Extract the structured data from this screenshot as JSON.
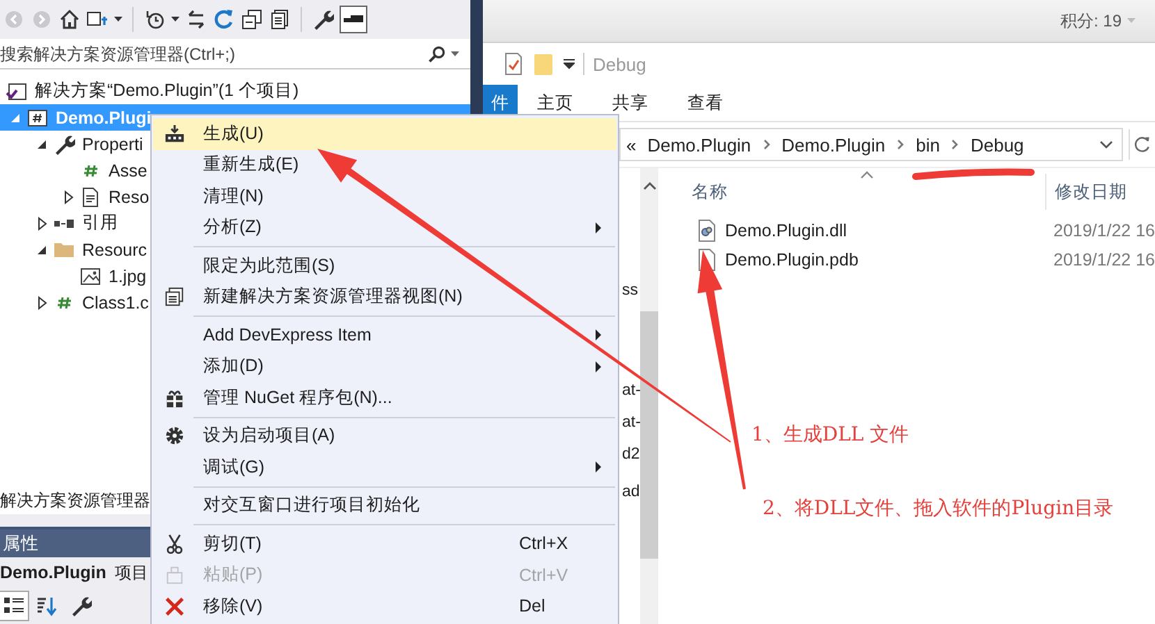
{
  "solution_explorer": {
    "search": {
      "placeholder": "搜索解决方案资源管理器(Ctrl+;)"
    },
    "solution": {
      "label": "解决方案“Demo.Plugin”(1 个项目)",
      "selected": false
    },
    "tree": [
      {
        "label": "Demo.Plugi",
        "kind": "project",
        "expanded": true,
        "selected": true,
        "children": [
          {
            "label": "Properti",
            "kind": "properties",
            "expanded": true,
            "selected": false,
            "children": [
              {
                "label": "Asse",
                "kind": "code",
                "selected": false
              },
              {
                "label": "Reso",
                "kind": "resx",
                "expanded": false,
                "selected": false
              }
            ]
          },
          {
            "label": "引用",
            "kind": "references",
            "expanded": false,
            "selected": false
          },
          {
            "label": "Resourc",
            "kind": "folder",
            "expanded": true,
            "selected": false,
            "children": [
              {
                "label": "1.jpg",
                "kind": "image",
                "selected": false
              }
            ]
          },
          {
            "label": "Class1.c",
            "kind": "code",
            "expanded": false,
            "selected": false
          }
        ]
      }
    ],
    "tab_label": "解决方案资源管理器",
    "properties": {
      "title": "属性",
      "object_name": "Demo.Plugin",
      "object_type": "项目"
    }
  },
  "context_menu": [
    {
      "kind": "build",
      "label": "生成(U)",
      "highlighted": true
    },
    {
      "kind": "plain",
      "label": "重新生成(E)",
      "highlighted": false
    },
    {
      "kind": "plain",
      "label": "清理(N)",
      "highlighted": false
    },
    {
      "kind": "plain",
      "label": "分析(Z)",
      "submenu": true,
      "highlighted": false
    },
    {
      "kind": "separator"
    },
    {
      "kind": "plain",
      "label": "限定为此范围(S)",
      "highlighted": false
    },
    {
      "kind": "view",
      "label": "新建解决方案资源管理器视图(N)",
      "highlighted": false
    },
    {
      "kind": "separator"
    },
    {
      "kind": "plain",
      "label": "Add DevExpress Item",
      "submenu": true,
      "highlighted": false
    },
    {
      "kind": "plain",
      "label": "添加(D)",
      "submenu": true,
      "highlighted": false
    },
    {
      "kind": "package",
      "label": "管理 NuGet 程序包(N)...",
      "highlighted": false
    },
    {
      "kind": "separator"
    },
    {
      "kind": "gear",
      "label": "设为启动项目(A)",
      "highlighted": false
    },
    {
      "kind": "plain",
      "label": "调试(G)",
      "submenu": true,
      "highlighted": false
    },
    {
      "kind": "separator"
    },
    {
      "kind": "plain",
      "label": "对交互窗口进行项目初始化",
      "highlighted": false
    },
    {
      "kind": "separator"
    },
    {
      "kind": "cut",
      "label": "剪切(T)",
      "shortcut": "Ctrl+X",
      "highlighted": false
    },
    {
      "kind": "paste",
      "label": "粘贴(P)",
      "shortcut": "Ctrl+V",
      "disabled": true,
      "highlighted": false
    },
    {
      "kind": "remove",
      "label": "移除(V)",
      "shortcut": "Del",
      "highlighted": false
    }
  ],
  "explorer": {
    "points": "积分: 19",
    "title": "Debug",
    "ribbon_tabs": [
      {
        "label": "件",
        "selected": true
      },
      {
        "label": "主页",
        "selected": false
      },
      {
        "label": "共享",
        "selected": false
      },
      {
        "label": "查看",
        "selected": false
      }
    ],
    "overflow_mark": "«",
    "breadcrumb": [
      "Demo.Plugin",
      "Demo.Plugin",
      "bin",
      "Debug"
    ],
    "nav_items": [
      "ss",
      "at-",
      "at-",
      "d2",
      "ad"
    ],
    "columns": [
      "名称",
      "修改日期"
    ],
    "files": [
      {
        "name": "Demo.Plugin.dll",
        "kind": "dll",
        "modified": "2019/1/22 16"
      },
      {
        "name": "Demo.Plugin.pdb",
        "kind": "pdb",
        "modified": "2019/1/22 16"
      }
    ]
  },
  "annotations": [
    {
      "text": "1、生成DLL 文件"
    },
    {
      "text": "2、将DLL文件、拖入软件的Plugin目录"
    }
  ]
}
